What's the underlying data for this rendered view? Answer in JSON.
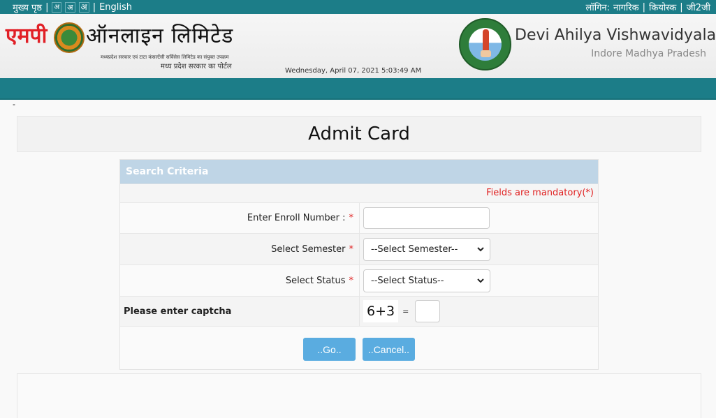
{
  "topbar": {
    "home_link": "मुख्य पृष्ठ",
    "font_sizes": [
      "अ",
      "अ",
      "अ"
    ],
    "language_link": "English",
    "login_label": "लॉगिन:",
    "login_links": [
      "नागरिक",
      "कियोस्क",
      "जी2जी"
    ],
    "separator": "|"
  },
  "header": {
    "mp_logo_red": "एमपी",
    "mp_logo_black": "ऑनलाइन लिमिटेड",
    "mp_tagline": "मध्यप्रदेश सरकार एवं टाटा कंसल्टेंसी सर्विसेस लिमिटेड का संयुक्त उपक्रम",
    "mp_portal": "मध्य प्रदेश सरकार का पोर्टल",
    "datetime": "Wednesday, April 07, 2021 5:03:49 AM",
    "university_name": "Devi Ahilya Vishwavidyalaya",
    "university_location": "Indore Madhya Pradesh"
  },
  "page": {
    "dash": "-",
    "title": "Admit Card"
  },
  "form": {
    "section_title": "Search Criteria",
    "mandatory_note": "Fields are mandatory(*)",
    "required_marker": "*",
    "enroll_label": "Enter Enroll Number :",
    "enroll_value": "",
    "semester_label": "Select Semester",
    "semester_selected": "--Select Semester--",
    "status_label": "Select Status",
    "status_selected": "--Select Status--",
    "captcha_label": "Please enter captcha",
    "captcha_question": "6+3",
    "captcha_equals": "=",
    "captcha_value": "",
    "go_button": "..Go..",
    "cancel_button": "..Cancel.."
  },
  "colors": {
    "topbar": "#1c7d88",
    "section_header": "#bfd5e6",
    "button": "#5aace0",
    "required": "#e02020"
  }
}
